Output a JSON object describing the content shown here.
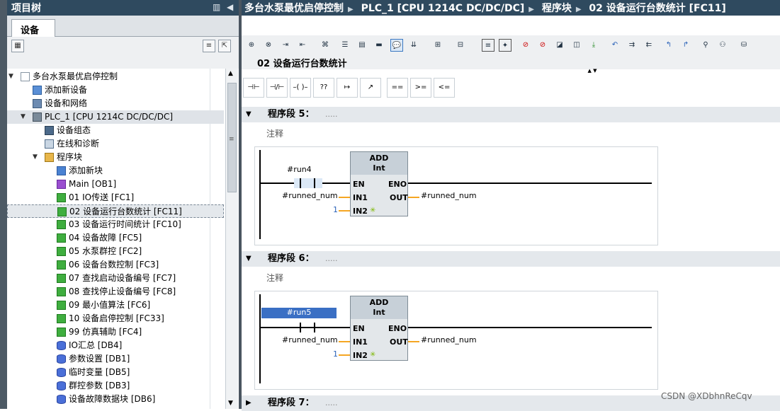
{
  "tree_panel": {
    "title": "项目树",
    "tab_label": "设备",
    "items": [
      {
        "label": "多台水泵最优启停控制",
        "level": 0,
        "expanded": true,
        "icon": "project-icon"
      },
      {
        "label": "添加新设备",
        "level": 1,
        "icon": "add-device-icon"
      },
      {
        "label": "设备和网络",
        "level": 1,
        "icon": "network-icon"
      },
      {
        "label": "PLC_1 [CPU 1214C DC/DC/DC]",
        "level": 1,
        "expanded": true,
        "icon": "plc-icon",
        "highlight": true
      },
      {
        "label": "设备组态",
        "level": 2,
        "icon": "device-config-icon"
      },
      {
        "label": "在线和诊断",
        "level": 2,
        "icon": "online-diag-icon"
      },
      {
        "label": "程序块",
        "level": 2,
        "expanded": true,
        "icon": "folder-icon"
      },
      {
        "label": "添加新块",
        "level": 3,
        "icon": "add-block-icon"
      },
      {
        "label": "Main [OB1]",
        "level": 3,
        "icon": "ob-icon"
      },
      {
        "label": "01 IO传送 [FC1]",
        "level": 3,
        "icon": "fc-icon"
      },
      {
        "label": "02 设备运行台数统计 [FC11]",
        "level": 3,
        "icon": "fc-icon",
        "selected": true
      },
      {
        "label": "03 设备运行时间统计 [FC10]",
        "level": 3,
        "icon": "fc-icon"
      },
      {
        "label": "04 设备故障 [FC5]",
        "level": 3,
        "icon": "fc-icon"
      },
      {
        "label": "05 水泵群控 [FC2]",
        "level": 3,
        "icon": "fc-icon"
      },
      {
        "label": "06 设备台数控制 [FC3]",
        "level": 3,
        "icon": "fc-icon"
      },
      {
        "label": "07 查找启动设备编号 [FC7]",
        "level": 3,
        "icon": "fc-icon"
      },
      {
        "label": "08 查找停止设备编号 [FC8]",
        "level": 3,
        "icon": "fc-icon"
      },
      {
        "label": "09 最小值算法 [FC6]",
        "level": 3,
        "icon": "fc-icon"
      },
      {
        "label": "10 设备启停控制 [FC33]",
        "level": 3,
        "icon": "fc-icon"
      },
      {
        "label": "99 仿真辅助 [FC4]",
        "level": 3,
        "icon": "fc-icon"
      },
      {
        "label": "IO汇总 [DB4]",
        "level": 3,
        "icon": "db-icon"
      },
      {
        "label": "参数设置 [DB1]",
        "level": 3,
        "icon": "db-icon"
      },
      {
        "label": "临时变量 [DB5]",
        "level": 3,
        "icon": "db-icon"
      },
      {
        "label": "群控参数 [DB3]",
        "level": 3,
        "icon": "db-icon"
      },
      {
        "label": "设备故障数据块 [DB6]",
        "level": 3,
        "icon": "db-icon"
      }
    ]
  },
  "editor": {
    "breadcrumb": [
      "多台水泵最优启停控制",
      "PLC_1 [CPU 1214C DC/DC/DC]",
      "程序块",
      "02 设备运行台数统计 [FC11]"
    ],
    "block_title": "02 设备运行台数统计",
    "ladder_buttons": [
      "⊣⊢",
      "⊣/⊢",
      "–( )–",
      "??",
      "↦",
      "↗",
      "==",
      ">=",
      "<="
    ],
    "networks": [
      {
        "title": "程序段 5：",
        "dots": ".....",
        "comment": "注释",
        "contact": "#run4",
        "instr": "ADD",
        "type": "Int",
        "in1": "#runned_num",
        "in2": "1",
        "out": "#runned_num",
        "pins": {
          "en": "EN",
          "eno": "ENO",
          "in1": "IN1",
          "in2": "IN2",
          "out": "OUT"
        }
      },
      {
        "title": "程序段 6：",
        "dots": ".....",
        "comment": "注释",
        "contact": "#run5",
        "instr": "ADD",
        "type": "Int",
        "in1": "#runned_num",
        "in2": "1",
        "out": "#runned_num",
        "pins": {
          "en": "EN",
          "eno": "ENO",
          "in1": "IN1",
          "in2": "IN2",
          "out": "OUT"
        }
      },
      {
        "title": "程序段 7：",
        "dots": "....."
      }
    ]
  },
  "watermark": "CSDN @XDbhnReCqv"
}
